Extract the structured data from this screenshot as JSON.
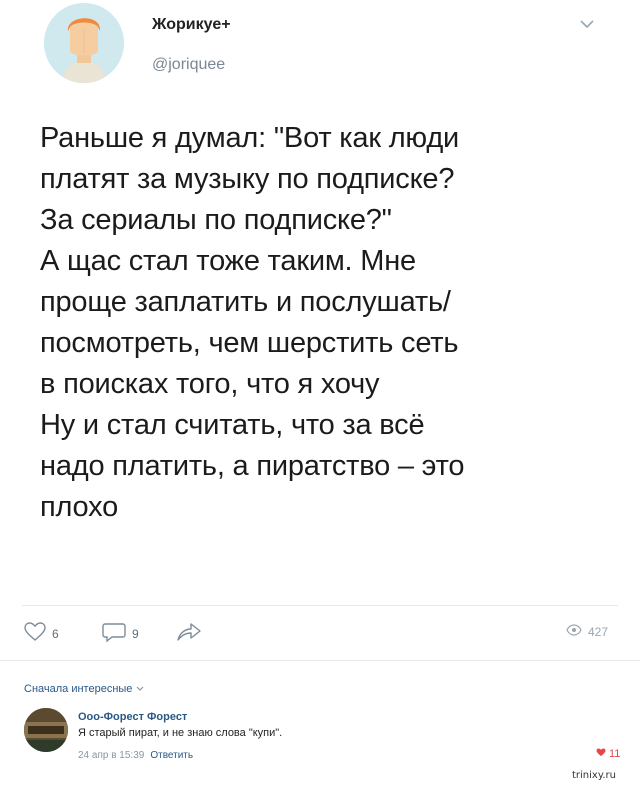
{
  "post": {
    "author_name": "Жорикуе+",
    "author_handle": "@joriquee",
    "text_lines": [
      "Раньше я думал: \"Вот как люди",
      "платят за музыку по подписке?",
      "За сериалы по подписке?\"",
      "А щас стал тоже таким. Мне",
      "проще заплатить и послушать/",
      "посмотреть, чем шерстить сеть",
      "в поисках того, что я хочу",
      "Ну и стал считать, что за всё",
      "надо платить, а пиратство – это",
      "плохо"
    ],
    "likes": "6",
    "comments": "9",
    "views": "427"
  },
  "comments_section": {
    "sort_label": "Сначала интересные",
    "items": [
      {
        "author": "Ооо-Форест Форест",
        "text": "Я старый пират, и не знаю слова \"купи\".",
        "date": "24 апр в 15:39",
        "reply_label": "Ответить",
        "likes": "11"
      }
    ]
  },
  "watermark": "trinixy.ru",
  "colors": {
    "link": "#2a5885",
    "like_active": "#e64646",
    "muted": "#7a8794"
  }
}
